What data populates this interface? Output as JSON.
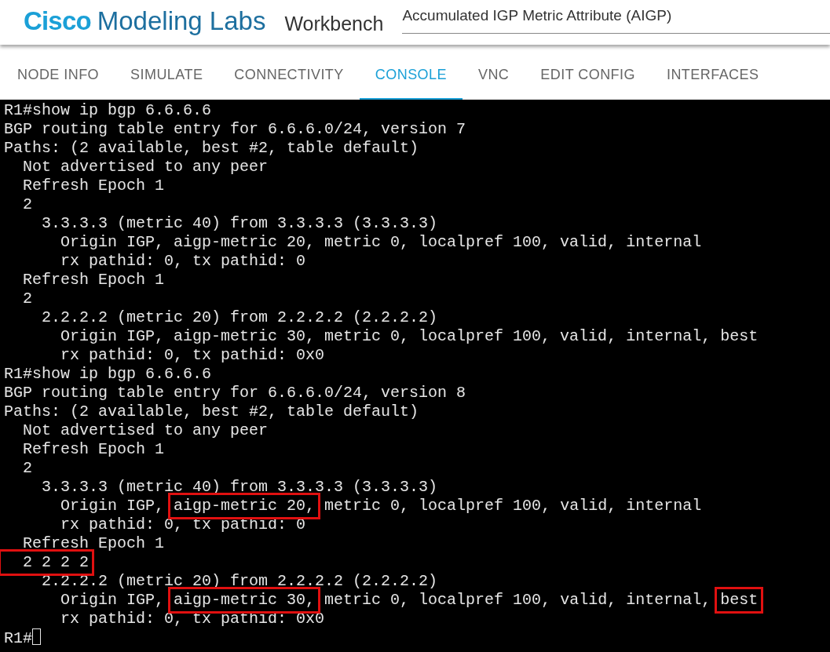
{
  "header": {
    "brand_bold": "Cisco",
    "brand_rest": "Modeling Labs",
    "app": "Workbench",
    "lab_title": "Accumulated IGP Metric Attribute (AIGP)"
  },
  "tabs": [
    {
      "label": "NODE INFO",
      "selected": false
    },
    {
      "label": "SIMULATE",
      "selected": false
    },
    {
      "label": "CONNECTIVITY",
      "selected": false
    },
    {
      "label": "CONSOLE",
      "selected": true
    },
    {
      "label": "VNC",
      "selected": false
    },
    {
      "label": "EDIT CONFIG",
      "selected": false
    },
    {
      "label": "INTERFACES",
      "selected": false
    }
  ],
  "console": {
    "cursor": true,
    "lines": [
      [
        {
          "text": "R1#show ip bgp 6.6.6.6",
          "boxed": false
        }
      ],
      [
        {
          "text": "BGP routing table entry for 6.6.6.0/24, version 7",
          "boxed": false
        }
      ],
      [
        {
          "text": "Paths: (2 available, best #2, table default)",
          "boxed": false
        }
      ],
      [
        {
          "text": "  Not advertised to any peer",
          "boxed": false
        }
      ],
      [
        {
          "text": "  Refresh Epoch 1",
          "boxed": false
        }
      ],
      [
        {
          "text": "  2",
          "boxed": false
        }
      ],
      [
        {
          "text": "    3.3.3.3 (metric 40) from 3.3.3.3 (3.3.3.3)",
          "boxed": false
        }
      ],
      [
        {
          "text": "      Origin IGP, aigp-metric 20, metric 0, localpref 100, valid, internal",
          "boxed": false
        }
      ],
      [
        {
          "text": "      rx pathid: 0, tx pathid: 0",
          "boxed": false
        }
      ],
      [
        {
          "text": "  Refresh Epoch 1",
          "boxed": false
        }
      ],
      [
        {
          "text": "  2",
          "boxed": false
        }
      ],
      [
        {
          "text": "    2.2.2.2 (metric 20) from 2.2.2.2 (2.2.2.2)",
          "boxed": false
        }
      ],
      [
        {
          "text": "      Origin IGP, aigp-metric 30, metric 0, localpref 100, valid, internal, best",
          "boxed": false
        }
      ],
      [
        {
          "text": "      rx pathid: 0, tx pathid: 0x0",
          "boxed": false
        }
      ],
      [
        {
          "text": "R1#show ip bgp 6.6.6.6",
          "boxed": false
        }
      ],
      [
        {
          "text": "BGP routing table entry for 6.6.6.0/24, version 8",
          "boxed": false
        }
      ],
      [
        {
          "text": "Paths: (2 available, best #2, table default)",
          "boxed": false
        }
      ],
      [
        {
          "text": "  Not advertised to any peer",
          "boxed": false
        }
      ],
      [
        {
          "text": "  Refresh Epoch 1",
          "boxed": false
        }
      ],
      [
        {
          "text": "  2",
          "boxed": false
        }
      ],
      [
        {
          "text": "    3.3.3.3 (metric 40) from 3.3.3.3 (3.3.3.3)",
          "boxed": false
        }
      ],
      [
        {
          "text": "      Origin IGP, ",
          "boxed": false
        },
        {
          "text": "aigp-metric 20,",
          "boxed": true
        },
        {
          "text": " metric 0, localpref 100, valid, internal",
          "boxed": false
        }
      ],
      [
        {
          "text": "      rx pathid: 0, tx pathid: 0",
          "boxed": false
        }
      ],
      [
        {
          "text": "  Refresh Epoch 1",
          "boxed": false
        }
      ],
      [
        {
          "text": "  2 2 2 2",
          "boxed": true
        }
      ],
      [
        {
          "text": "    2.2.2.2 (metric 20) from 2.2.2.2 (2.2.2.2)",
          "boxed": false
        }
      ],
      [
        {
          "text": "      Origin IGP, ",
          "boxed": false
        },
        {
          "text": "aigp-metric 30,",
          "boxed": true
        },
        {
          "text": " metric 0, localpref 100, valid, internal, ",
          "boxed": false
        },
        {
          "text": "best",
          "boxed": true
        }
      ],
      [
        {
          "text": "      rx pathid: 0, tx pathid: 0x0",
          "boxed": false
        }
      ],
      [
        {
          "text": "R1#",
          "boxed": false
        }
      ]
    ]
  }
}
